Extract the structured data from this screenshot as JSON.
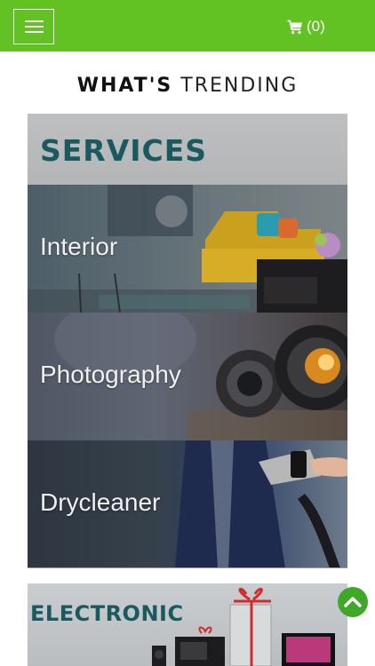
{
  "header": {
    "cart_count": "(0)",
    "menu_icon": "hamburger-menu-icon",
    "cart_icon": "shopping-cart-icon",
    "accent_color": "#62c123"
  },
  "trending": {
    "title_bold": "WHAT'S",
    "title_light": "TRENDING"
  },
  "services_card": {
    "heading": "SERVICES",
    "items": [
      {
        "label": "Interior"
      },
      {
        "label": "Photography"
      },
      {
        "label": "Drycleaner"
      }
    ]
  },
  "electronic_card": {
    "heading": "ELECTRONIC"
  },
  "back_to_top": {
    "icon": "chevron-up-icon",
    "color": "#3fa829"
  }
}
